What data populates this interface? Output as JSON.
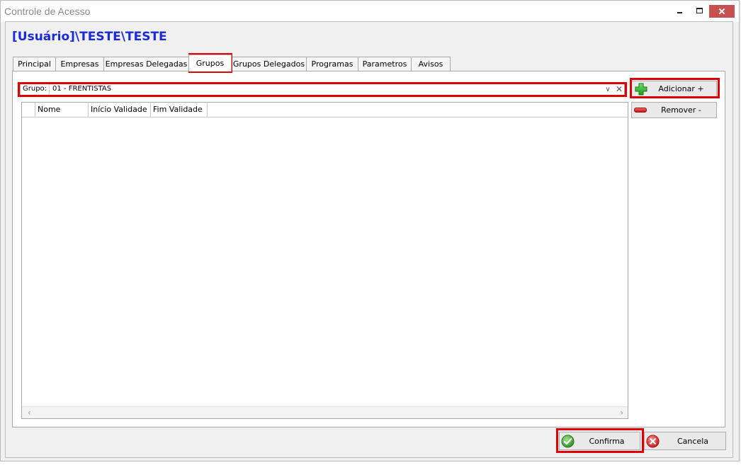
{
  "window": {
    "title": "Controle de Acesso"
  },
  "page_title": "[Usuário]\\TESTE\\TESTE",
  "tabs": [
    {
      "label": "Principal"
    },
    {
      "label": "Empresas"
    },
    {
      "label": "Empresas Delegadas"
    },
    {
      "label": "Grupos",
      "active": true
    },
    {
      "label": "Grupos Delegados"
    },
    {
      "label": "Programas"
    },
    {
      "label": "Parametros"
    },
    {
      "label": "Avisos"
    }
  ],
  "group_field": {
    "label": "Grupo:",
    "value": "01 - FRENTISTAS"
  },
  "grid": {
    "columns": [
      "Nome",
      "Início Validade",
      "Fim Validade"
    ],
    "rows": []
  },
  "buttons": {
    "add": "Adicionar +",
    "remove": "Remover -",
    "confirm": "Confirma",
    "cancel": "Cancela"
  },
  "colors": {
    "title_blue": "#1a2ad8",
    "highlight_red": "#e00000",
    "close_red": "#c75050"
  }
}
